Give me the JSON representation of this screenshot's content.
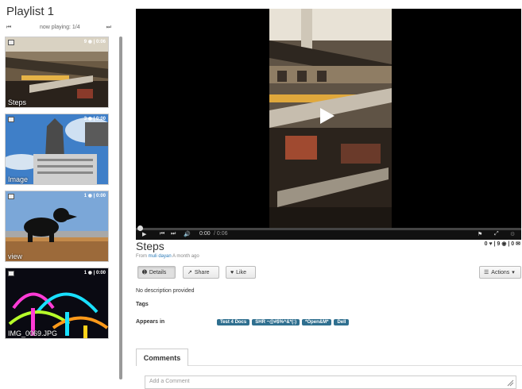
{
  "playlist": {
    "title": "Playlist 1",
    "now_playing": "now playing: 1/4",
    "prev_icon": "skip-back-icon",
    "next_icon": "skip-forward-icon",
    "items": [
      {
        "label": "Steps",
        "type": "video",
        "stats": "9 ◉ | 0:06"
      },
      {
        "label": "Image",
        "type": "image",
        "stats": "3 ◉ | 0:00"
      },
      {
        "label": "view",
        "type": "image",
        "stats": "1 ◉ | 0:00"
      },
      {
        "label": "IMG_0069.JPG",
        "type": "image",
        "stats": "1 ◉ | 0:00"
      }
    ]
  },
  "player": {
    "time": "0:00",
    "duration": "/ 0:06",
    "progress": 0
  },
  "media": {
    "title": "Steps",
    "from_prefix": "From",
    "user": "muli dayan",
    "age": "A month ago",
    "counts": "0 ♥ | 9 ◉ | 0 ✉",
    "description": "No description provided",
    "tags_label": "Tags",
    "appears_label": "Appears in",
    "appears_in": [
      "Test 4 Docs",
      "SHR ~@#$%^&*(:)",
      "*Open&M*",
      "Dell"
    ]
  },
  "buttons": {
    "details": "Details",
    "share": "Share",
    "like": "Like",
    "actions": "Actions"
  },
  "comments": {
    "tab_label": "Comments",
    "placeholder": "Add a Comment"
  },
  "colors": {
    "pill": "#2f6f8f",
    "link": "#2a7ab8"
  }
}
